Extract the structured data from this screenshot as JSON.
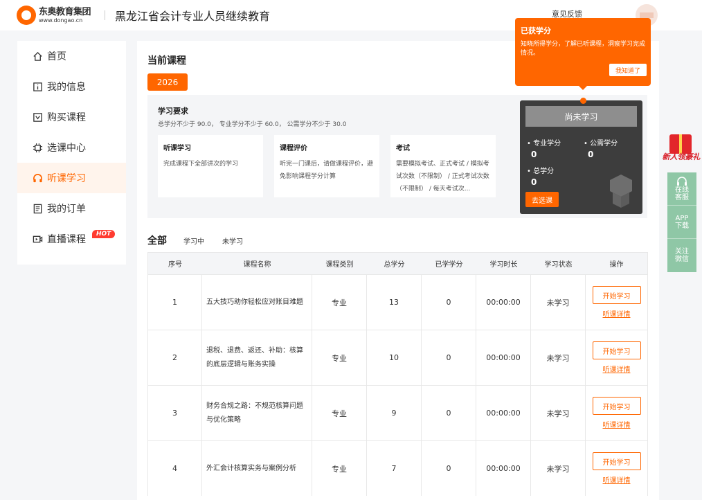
{
  "header": {
    "logo_cn": "东奥教育集团",
    "logo_en": "www.dongao.cn",
    "site_title": "黑龙江省会计专业人员继续教育",
    "feedback": "意见反馈"
  },
  "sidebar": {
    "items": [
      {
        "label": "首页",
        "icon": "home-icon"
      },
      {
        "label": "我的信息",
        "icon": "info-icon"
      },
      {
        "label": "购买课程",
        "icon": "cart-icon"
      },
      {
        "label": "选课中心",
        "icon": "chip-icon"
      },
      {
        "label": "听课学习",
        "icon": "headphone-icon",
        "active": true
      },
      {
        "label": "我的订单",
        "icon": "order-icon"
      },
      {
        "label": "直播课程",
        "icon": "live-icon"
      }
    ],
    "hot_badge": "HOT"
  },
  "main": {
    "section_title": "当前课程",
    "year_tab": "2026",
    "requirements": {
      "title": "学习要求",
      "desc": "总学分不少于 90.0， 专业学分不少于 60.0， 公需学分不少于 30.0",
      "cards": [
        {
          "title": "听课学习",
          "text": "完成课程下全部讲次的学习"
        },
        {
          "title": "课程评价",
          "text": "听完一门课后，请做课程评价，避免影响课程学分计算"
        },
        {
          "title": "考试",
          "text": "需要模拟考试、正式考试 / 模拟考试次数（不限制） / 正式考试次数（不限制） / 每天考试次..."
        }
      ]
    },
    "status_card": {
      "banner": "尚未学习",
      "major_label": "• 专业学分",
      "major_value": "0",
      "public_label": "• 公需学分",
      "public_value": "0",
      "total_label": "• 总学分",
      "total_value": "0",
      "select_button": "去选课"
    },
    "filters": {
      "all": "全部",
      "studying": "学习中",
      "not_studied": "未学习"
    },
    "table": {
      "headers": [
        "序号",
        "课程名称",
        "课程类别",
        "总学分",
        "已学学分",
        "学习时长",
        "学习状态",
        "操作"
      ],
      "rows": [
        {
          "no": "1",
          "name": "五大技巧助你轻松应对账目难题",
          "type": "专业",
          "total": "13",
          "earned": "0",
          "duration": "00:00:00",
          "status": "未学习"
        },
        {
          "no": "2",
          "name": "退税、退费、返还、补助：核算的底层逻辑与账务实操",
          "type": "专业",
          "total": "10",
          "earned": "0",
          "duration": "00:00:00",
          "status": "未学习"
        },
        {
          "no": "3",
          "name": "财务合规之路：不规范核算问题与优化策略",
          "type": "专业",
          "total": "9",
          "earned": "0",
          "duration": "00:00:00",
          "status": "未学习"
        },
        {
          "no": "4",
          "name": "外汇会计核算实务与案例分析",
          "type": "专业",
          "total": "7",
          "earned": "0",
          "duration": "00:00:00",
          "status": "未学习"
        }
      ],
      "start_label": "开始学习",
      "detail_label": "听课详情"
    }
  },
  "tooltip": {
    "title": "已获学分",
    "text": "知晓所得学分，了解已听课程，洞察学习完成情况。",
    "ok_button": "我知道了"
  },
  "float": {
    "gift_text": "新人领豪礼",
    "items": [
      "在线客服",
      "APP下载",
      "关注微信"
    ]
  },
  "colors": {
    "accent": "#ff6600",
    "float_bar": "#8fc7a6",
    "status_card": "#3d3d3d"
  }
}
